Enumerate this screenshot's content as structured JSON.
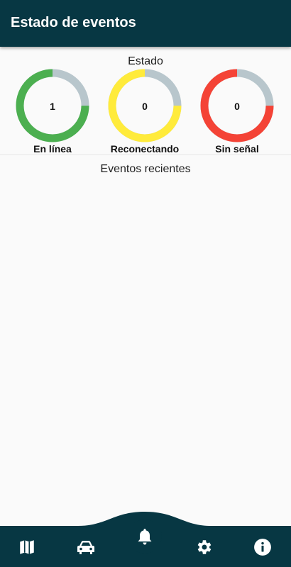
{
  "appbar": {
    "title": "Estado de eventos"
  },
  "status": {
    "title": "Estado",
    "gauges": [
      {
        "label": "En línea",
        "value": "1",
        "color": "#4caf50",
        "fraction": 0.75
      },
      {
        "label": "Reconectando",
        "value": "0",
        "color": "#ffeb3b",
        "fraction": 0.75
      },
      {
        "label": "Sin señal",
        "value": "0",
        "color": "#f44336",
        "fraction": 0.75
      }
    ],
    "track_color": "#b8c6cc"
  },
  "events": {
    "title": "Eventos recientes"
  },
  "nav": {
    "background": "#073743",
    "items": [
      {
        "icon": "map-icon"
      },
      {
        "icon": "car-icon"
      },
      {
        "icon": "bell-icon",
        "active": true
      },
      {
        "icon": "gear-icon"
      },
      {
        "icon": "info-icon"
      }
    ]
  }
}
